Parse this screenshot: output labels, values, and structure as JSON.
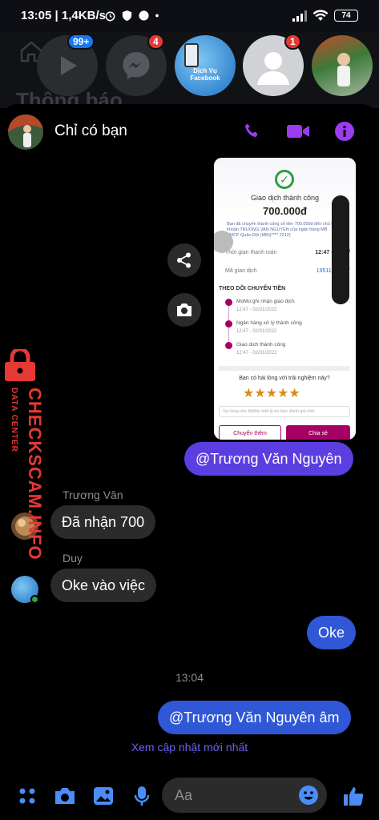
{
  "status_bar": {
    "time": "13:05",
    "net_speed": "1,4KB/s",
    "battery": "74"
  },
  "background_app": {
    "title": "Thông báo"
  },
  "chat_heads": [
    {
      "name": "video-app",
      "badge": "99+"
    },
    {
      "name": "messenger",
      "badge": "4"
    },
    {
      "name": "dich-vu-facebook",
      "label": "Dịch Vụ Facebook"
    },
    {
      "name": "contact",
      "badge": "1"
    },
    {
      "name": "contact-photo"
    }
  ],
  "chat": {
    "title": "Chỉ có bạn",
    "accent": "#9b3cf0"
  },
  "shared_receipt": {
    "title": "Giao dịch thành công",
    "amount": "700.000đ",
    "note": "Bạn đã chuyển thành công số tiền 700.000đ đến chủ tài khoản TRUONG VAN NGUYEN của ngân hàng MB TMCP Quân Đội (MB)(**** 2212)",
    "row_time_label": "Thời gian thanh toán",
    "row_time_value": "12:47 - 02/01/",
    "row_code_label": "Mã giao dịch",
    "row_code_value": "19511996417",
    "section_title": "THEO DÕI CHUYỂN TIỀN",
    "track": [
      {
        "label": "MoMo ghi nhận giao dịch",
        "time": "12:47 - 02/01/2022"
      },
      {
        "label": "Ngân hàng xử lý thành công",
        "time": "12:47 - 02/01/2022"
      },
      {
        "label": "Giao dịch thành công",
        "time": "12:47 - 02/01/2022"
      }
    ],
    "rate_question": "Bạn có hài lòng với trải nghiệm này?",
    "stars": "★★★★★",
    "rate_placeholder": "Vui lòng cho MoMo biết lý do bạn đánh giá nhé",
    "btn_more": "Chuyển thêm",
    "btn_share": "Chia sẻ"
  },
  "messages": {
    "out_mention": "@Trương Văn Nguyên",
    "sender1": "Trương Văn",
    "in1": "Đã nhận 700",
    "sender2": "Duy",
    "in2": "Oke vào việc",
    "out_oke": "Oke",
    "time": "13:04",
    "out_mention2": "@Trương Văn Nguyên âm",
    "see_newer": "Xem cập nhật mới nhất"
  },
  "watermark": {
    "brand": "CHECKSCAM.INFO",
    "sub": "DATA CENTER"
  },
  "composer": {
    "placeholder": "Aa"
  }
}
